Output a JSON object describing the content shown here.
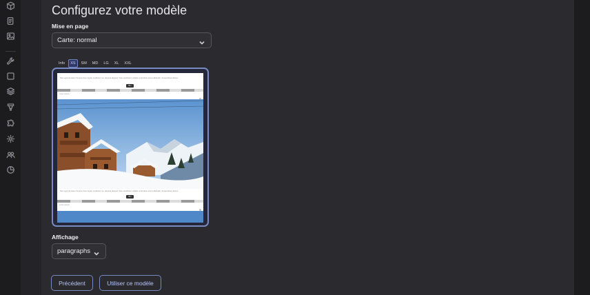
{
  "sidebar": {
    "items": [
      {
        "icon": "cube-icon"
      },
      {
        "icon": "documents-icon"
      },
      {
        "icon": "images-icon"
      },
      {
        "icon": "wrench-icon"
      },
      {
        "icon": "square-icon"
      },
      {
        "icon": "layers-icon"
      },
      {
        "icon": "brush-icon"
      },
      {
        "icon": "puzzle-icon"
      },
      {
        "icon": "gear-icon"
      },
      {
        "icon": "users-icon"
      },
      {
        "icon": "pie-chart-icon"
      }
    ]
  },
  "page": {
    "title": "Configurez votre modèle"
  },
  "layout_section": {
    "label": "Mise en page",
    "selected": "Carte: normal"
  },
  "preview_tabs": [
    "Info",
    "XS",
    "SM",
    "MD",
    "LG",
    "XL",
    "XXL"
  ],
  "preview_tabs_active": "XS",
  "preview": {
    "text_line": "Nam eget dui etiam rhoncus lorem ligula, vestibulum ac, placerat aliquam. Duis vestibulum sodales at tincidunt amet sollicitudin. Suspendisse ultrices.",
    "button": "Btn",
    "caption": "Lorem ipsum"
  },
  "display_section": {
    "label": "Affichage",
    "selected": "paragraphs"
  },
  "actions": {
    "previous": "Précédent",
    "use_template": "Utiliser ce modèle"
  },
  "colors": {
    "accent": "#7a8bc4",
    "background": "#2b2b2f",
    "sidebar": "#1c1c1f"
  }
}
